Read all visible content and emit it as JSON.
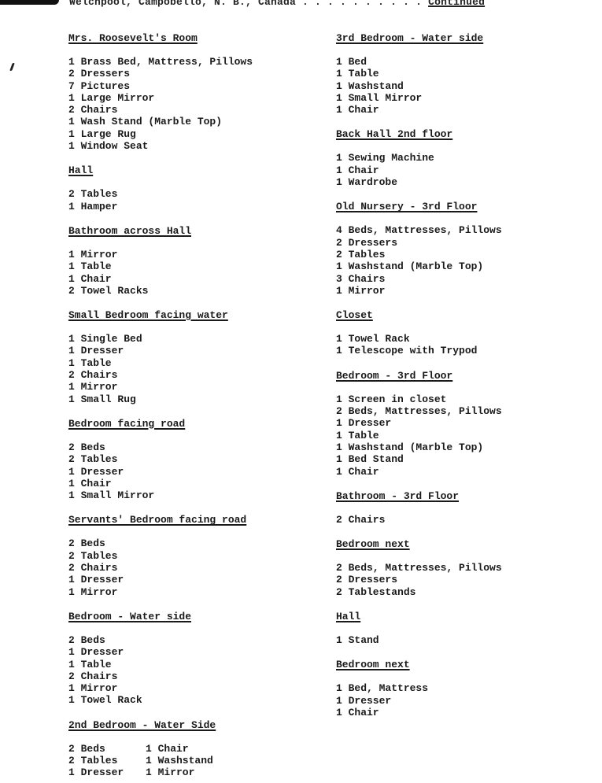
{
  "header": {
    "location": "Welchpool, Campobello, N. B., Canada",
    "leader": " . . . . . . . . . . ",
    "continued": "Continued"
  },
  "left_column": [
    {
      "title": "Mrs. Roosevelt's Room",
      "items": [
        "1 Brass Bed, Mattress, Pillows",
        "2 Dressers",
        "7 Pictures",
        "1 Large Mirror",
        "2 Chairs",
        "1 Wash Stand (Marble Top)",
        "1 Large Rug",
        "1 Window Seat"
      ]
    },
    {
      "title": "Hall",
      "items": [
        "2 Tables",
        "1 Hamper"
      ]
    },
    {
      "title": "Bathroom across Hall",
      "items": [
        "1 Mirror",
        "1 Table",
        "1 Chair",
        "2 Towel Racks"
      ]
    },
    {
      "title": "Small Bedroom facing water",
      "items": [
        "1 Single Bed",
        "1 Dresser",
        "1 Table",
        "2 Chairs",
        "1 Mirror",
        "1 Small Rug"
      ]
    },
    {
      "title": "Bedroom facing road",
      "items": [
        "2 Beds",
        "2 Tables",
        "1 Dresser",
        "1 Chair",
        "1 Small Mirror"
      ]
    },
    {
      "title": "Servants' Bedroom facing road",
      "items": [
        "2 Beds",
        "2 Tables",
        "2 Chairs",
        "1 Dresser",
        "1 Mirror"
      ]
    },
    {
      "title": "Bedroom - Water side",
      "items": [
        "2 Beds",
        "1 Dresser",
        "1 Table",
        "2 Chairs",
        "1 Mirror",
        "1 Towel Rack"
      ]
    },
    {
      "title": "2nd Bedroom - Water Side",
      "items_a": [
        "2 Beds",
        "2 Tables",
        "1 Dresser"
      ],
      "items_b": [
        "1 Chair",
        "1 Washstand",
        "1 Mirror"
      ]
    }
  ],
  "right_column": [
    {
      "title": "3rd Bedroom - Water side",
      "items": [
        "1 Bed",
        "1 Table",
        "1 Washstand",
        "1 Small Mirror",
        "1 Chair"
      ]
    },
    {
      "title": "Back Hall 2nd floor",
      "items": [
        "1 Sewing Machine",
        "1 Chair",
        "1 Wardrobe"
      ]
    },
    {
      "title": "Old Nursery - 3rd Floor",
      "items": [
        "4 Beds, Mattresses, Pillows",
        "2 Dressers",
        "2 Tables",
        "1 Washstand (Marble Top)",
        "3 Chairs",
        "1 Mirror"
      ]
    },
    {
      "title": "Closet",
      "items": [
        "1 Towel Rack",
        "1 Telescope with Trypod"
      ]
    },
    {
      "title": "Bedroom - 3rd Floor",
      "items": [
        "1 Screen in closet",
        "2 Beds, Mattresses, Pillows",
        "1 Dresser",
        "1 Table",
        "1 Washstand (Marble Top)",
        "1 Bed Stand",
        "1 Chair"
      ]
    },
    {
      "title": "Bathroom - 3rd Floor",
      "items": [
        "2 Chairs"
      ]
    },
    {
      "title": "Bedroom next",
      "items": [
        "2 Beds, Mattresses, Pillows",
        "2 Dressers",
        "2 Tablestands"
      ]
    },
    {
      "title": "Hall",
      "items": [
        "1 Stand"
      ]
    },
    {
      "title": "Bedroom next",
      "items": [
        "1 Bed, Mattress",
        "1 Dresser",
        "1 Chair"
      ]
    }
  ]
}
